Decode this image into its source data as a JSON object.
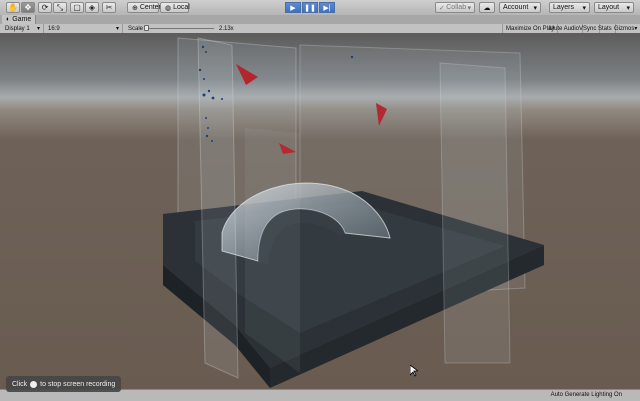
{
  "toolbar": {
    "tools": [
      "hand",
      "move",
      "rotate",
      "scale",
      "rect",
      "transform",
      "custom"
    ],
    "pivot": {
      "center_label": "Center",
      "local_label": "Local"
    },
    "collab_label": "Collab",
    "account_label": "Account",
    "layers_label": "Layers",
    "layout_label": "Layout"
  },
  "game_tab": {
    "title": "Game"
  },
  "game_controls": {
    "display": "Display 1",
    "aspect": "16:9",
    "scale_label": "Scale",
    "scale_value": "2.13x",
    "maximize_label": "Maximize On Play",
    "mute_label": "Mute Audio",
    "vsync_label": "VSync",
    "stats_label": "Stats",
    "gizmos_label": "Gizmos"
  },
  "status": {
    "lighting_text": "Auto Generate Lighting On"
  },
  "recording_toast": {
    "text_before": "Click",
    "text_after": "to stop screen recording"
  }
}
